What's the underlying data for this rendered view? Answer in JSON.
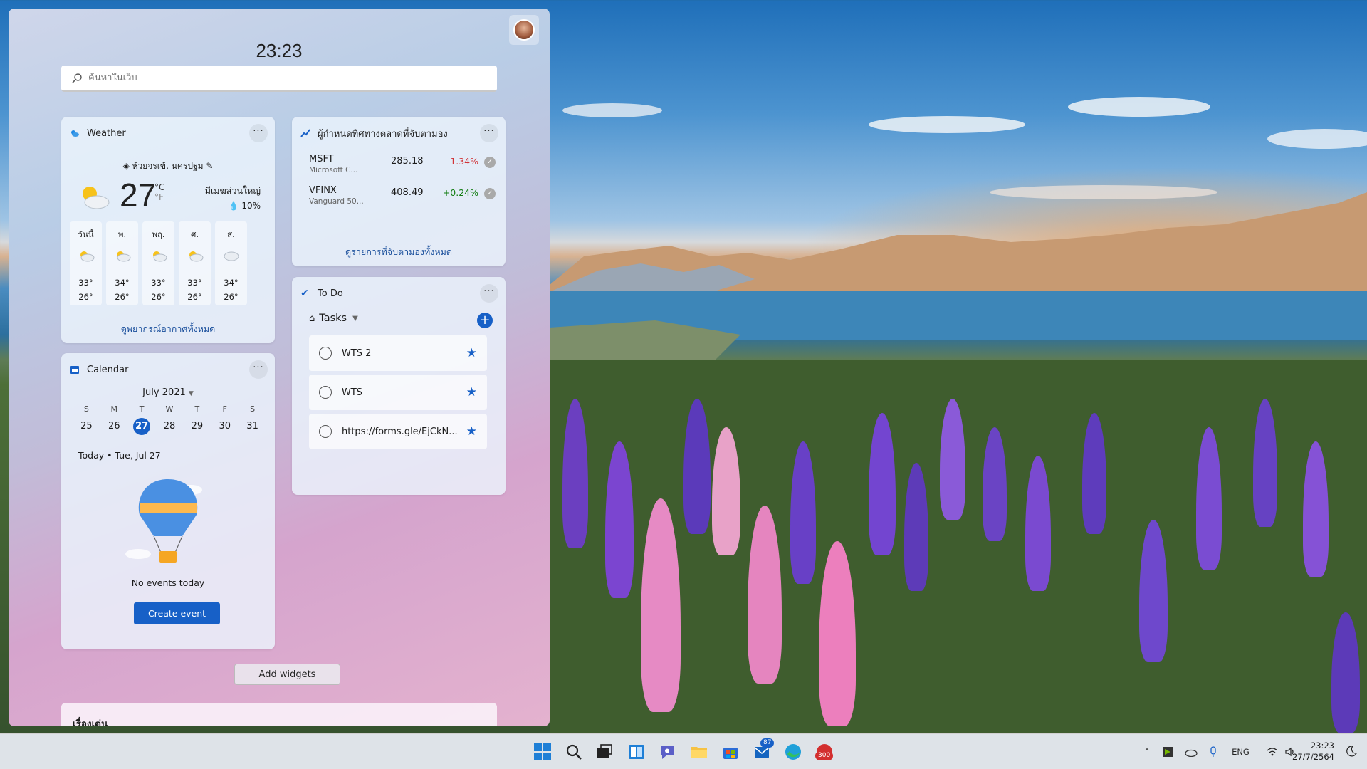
{
  "panel": {
    "time": "23:23",
    "search_placeholder": "ค้นหาในเว็บ",
    "add_widgets": "Add widgets",
    "featured_title": "เรื่องเด่น"
  },
  "weather": {
    "title": "Weather",
    "location": "ห้วยจรเข้, นครปฐม",
    "temp": "27",
    "unit_c": "°C",
    "unit_f": "°F",
    "condition": "มีเมฆส่วนใหญ่",
    "precip": "10%",
    "days": [
      {
        "label": "วันนี้",
        "hi": "33°",
        "lo": "26°",
        "icon": "partly-cloudy-rain-icon"
      },
      {
        "label": "พ.",
        "hi": "34°",
        "lo": "26°",
        "icon": "partly-cloudy-rain-icon"
      },
      {
        "label": "พฤ.",
        "hi": "33°",
        "lo": "26°",
        "icon": "partly-cloudy-rain-icon"
      },
      {
        "label": "ศ.",
        "hi": "33°",
        "lo": "26°",
        "icon": "partly-cloudy-rain-icon"
      },
      {
        "label": "ส.",
        "hi": "34°",
        "lo": "26°",
        "icon": "cloud-rain-icon"
      }
    ],
    "forecast_link": "ดูพยากรณ์อากาศทั้งหมด"
  },
  "markets": {
    "title": "ผู้กำหนดทิศทางตลาดที่จับตามอง",
    "rows": [
      {
        "symbol": "MSFT",
        "name": "Microsoft C...",
        "price": "285.18",
        "change": "-1.34%",
        "trend": "down"
      },
      {
        "symbol": "VFINX",
        "name": "Vanguard 50...",
        "price": "408.49",
        "change": "+0.24%",
        "trend": "up"
      }
    ],
    "watchlist_link": "ดูรายการที่จับตามองทั้งหมด"
  },
  "todo": {
    "title": "To Do",
    "list_name": "Tasks",
    "tasks": [
      {
        "text": "WTS 2",
        "starred": true
      },
      {
        "text": "WTS",
        "starred": true
      },
      {
        "text": "https://forms.gle/EjCkN...",
        "starred": true
      }
    ]
  },
  "calendar": {
    "title": "Calendar",
    "month": "July 2021",
    "weekdays": [
      "S",
      "M",
      "T",
      "W",
      "T",
      "F",
      "S"
    ],
    "dates": [
      "25",
      "26",
      "27",
      "28",
      "29",
      "30",
      "31"
    ],
    "today_index": 2,
    "today_label": "Today • Tue, Jul 27",
    "no_events": "No events today",
    "create_event": "Create event"
  },
  "taskbar": {
    "store_badge": "87",
    "app_badge": "300",
    "language": "ENG",
    "clock_time": "23:23",
    "clock_date": "27/7/2564",
    "accent_color": "#1760c7"
  }
}
